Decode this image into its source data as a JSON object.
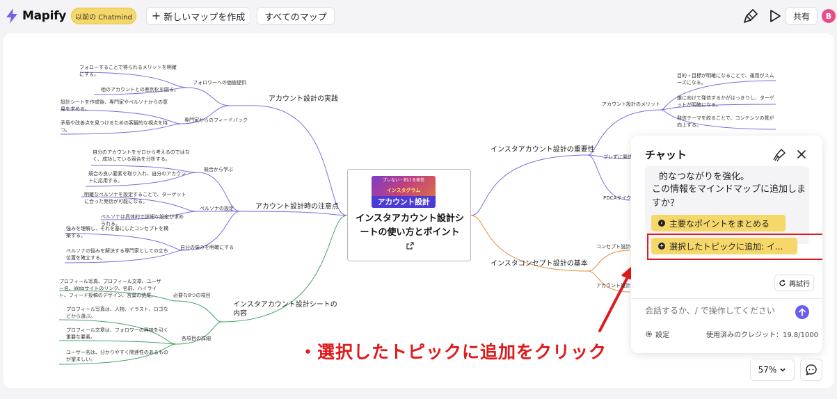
{
  "app": {
    "name": "Mapify",
    "old_chatmind_label": "以前の Chatmind",
    "new_map_label": "新しいマップを作成",
    "all_maps_label": "すべてのマップ",
    "share_label": "共有",
    "avatar_letter": "B",
    "accent_color": "#6a5cf0",
    "highlight_color": "#f6d86a"
  },
  "mindmap": {
    "center": {
      "image_top": "ブレない・刺さる発信",
      "image_mid": "インスタグラム",
      "image_band": "アカウント設計",
      "title": "インスタアカウント設計シートの使い方とポイント"
    },
    "left": [
      {
        "label": "アカウント設計の実践",
        "groups": [
          {
            "label": "フォロワーへの価値提供",
            "leaves": [
              "フォローすることで得られるメリットを明確にする。",
              "他のアカウントとの差別化を図る。"
            ]
          },
          {
            "label": "専門家からのフィードバック",
            "leaves": [
              "設計シートを作成後、専門家やペルソナからの意見を求める。",
              "矛盾や改善点を見つけるための客観的な視点を持つ。"
            ]
          }
        ]
      },
      {
        "label": "アカウント設計時の注意点",
        "groups": [
          {
            "label": "競合から学ぶ",
            "leaves": [
              "自分のアカウントをゼロから考えるのではなく、成功している競合を分析する。",
              "競合の良い要素を取り入れ、自分のアカウントに応用する。"
            ]
          },
          {
            "label": "ペルソナの設定",
            "leaves": [
              "明確なペルソナを設定することで、ターゲットに合った発信が可能になる。",
              "ペルソナは具体的で詳細な設定が求められる。"
            ]
          },
          {
            "label": "自分の強みを明確にする",
            "leaves": [
              "強みを理解し、それを基にしたコンセプトを構築する。",
              "ペルソナの悩みを解決する専門家としての立ち位置を確立する。"
            ]
          }
        ]
      },
      {
        "label": "インスタアカウント設計シートの内容",
        "groups": [
          {
            "label": "必要な8つの項目",
            "leaves": [
              "プロフィール写真、プロフィール文章、ユーザー名、Webサイトのリンク、名前、ハイライト、フィード投稿のデザイン、言葉の語尾。"
            ]
          },
          {
            "label": "各項目の詳細",
            "leaves": [
              "プロフィール写真は、人物、イラスト、ロゴなどから選ぶ。",
              "プロフィール文章は、フォロワーの興味を引く重要な要素。",
              "ユーザー名は、分かりやすく関連性のあるものが望ましい。"
            ]
          }
        ]
      }
    ],
    "right": [
      {
        "label": "インスタアカウント設計の重要性",
        "groups": [
          {
            "label": "アカウント設計のメリット",
            "leaves": [
              "目的・目標が明確になることで、運用がスムーズになる。",
              "誰に向けて発信するかがはっきりし、ターゲットが明確になる。",
              "発信テーマを絞ることで、コンテンツの質が向上する。"
            ]
          },
          {
            "label": "ブレずに発信",
            "leaves": []
          },
          {
            "label": "PDCAサイクル",
            "leaves": []
          }
        ]
      },
      {
        "label": "インスタコンセプト設計の基本",
        "groups": [
          {
            "label": "コンセプト設計の",
            "leaves": []
          },
          {
            "label": "アカウント設計",
            "leaves": []
          }
        ]
      }
    ]
  },
  "chat": {
    "title": "チャット",
    "previous_line_cut": "的なつながりを強化。",
    "message": "この情報をマインドマップに追加しますか？",
    "suggestion_1": "主要なポイントをまとめる",
    "suggestion_2": "選択したトピックに追加: イ...",
    "retry_label": "再試行",
    "input_placeholder": "会話するか、/ で操作してください",
    "settings_label": "設定",
    "credits_label": "使用済みのクレジット：19.8/1000"
  },
  "annotation": "・選択したトピックに追加をクリック",
  "zoom": "57%"
}
